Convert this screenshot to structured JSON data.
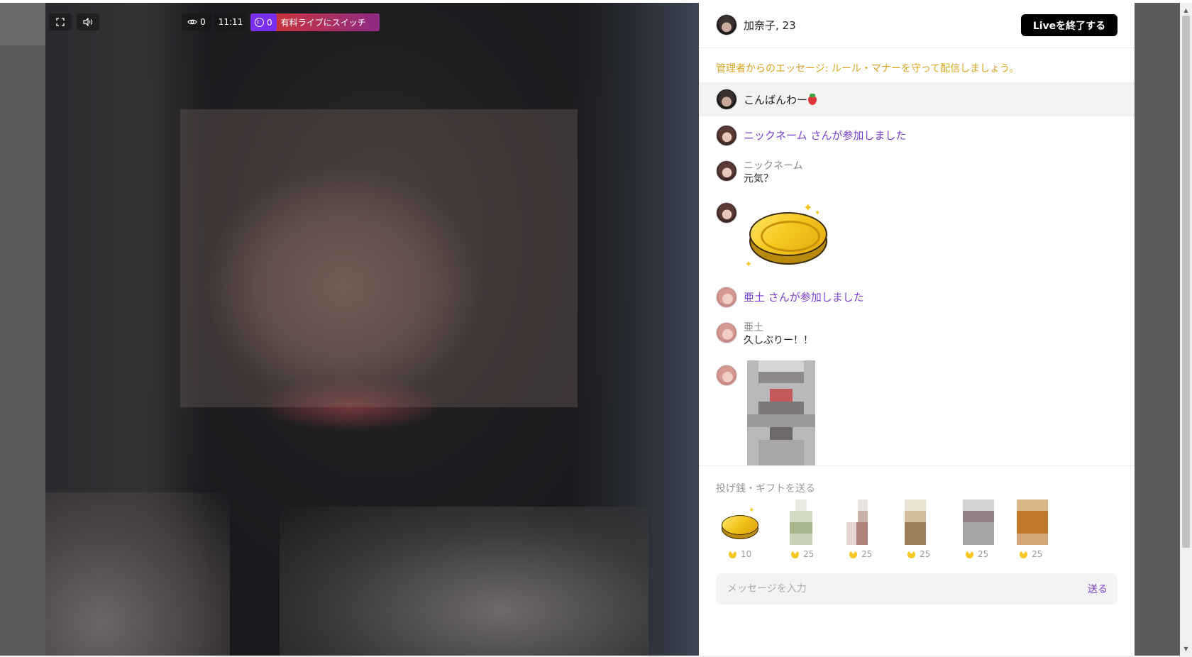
{
  "video": {
    "viewer_count": "0",
    "elapsed_time": "11:11",
    "coin_count": "0",
    "switch_label": "有料ライブにスイッチ"
  },
  "header": {
    "streamer_name": "加奈子, 23",
    "end_button_label": "Liveを終了する"
  },
  "admin_message": "管理者からのエッセージ: ルール・マナーを守って配信しましょう。",
  "pinned_message": "こんばんわー",
  "chat": [
    {
      "type": "join",
      "text": "ニックネーム さんが参加しました"
    },
    {
      "type": "message",
      "nickname": "ニックネーム",
      "text": "元気？"
    },
    {
      "type": "gift",
      "gift": "gold-coin"
    },
    {
      "type": "join",
      "text": "亜土 さんが参加しました"
    },
    {
      "type": "message",
      "nickname": "亜土",
      "text": "久しぶりー！！"
    },
    {
      "type": "photo"
    }
  ],
  "gifts": {
    "title": "投げ銭・ギフトを送る",
    "items": [
      {
        "name": "gold-coin",
        "price": "10"
      },
      {
        "name": "gift-2",
        "price": "25"
      },
      {
        "name": "gift-3",
        "price": "25"
      },
      {
        "name": "gift-4",
        "price": "25"
      },
      {
        "name": "gift-5",
        "price": "25"
      },
      {
        "name": "gift-6",
        "price": "25"
      }
    ]
  },
  "composer": {
    "placeholder": "メッセージを入力",
    "send_label": "送る"
  },
  "colors": {
    "accent_purple": "#7b3fd1",
    "admin_gold": "#d9a521",
    "switch_red": "#c8353e",
    "coin_purple": "#7a2ef0"
  }
}
